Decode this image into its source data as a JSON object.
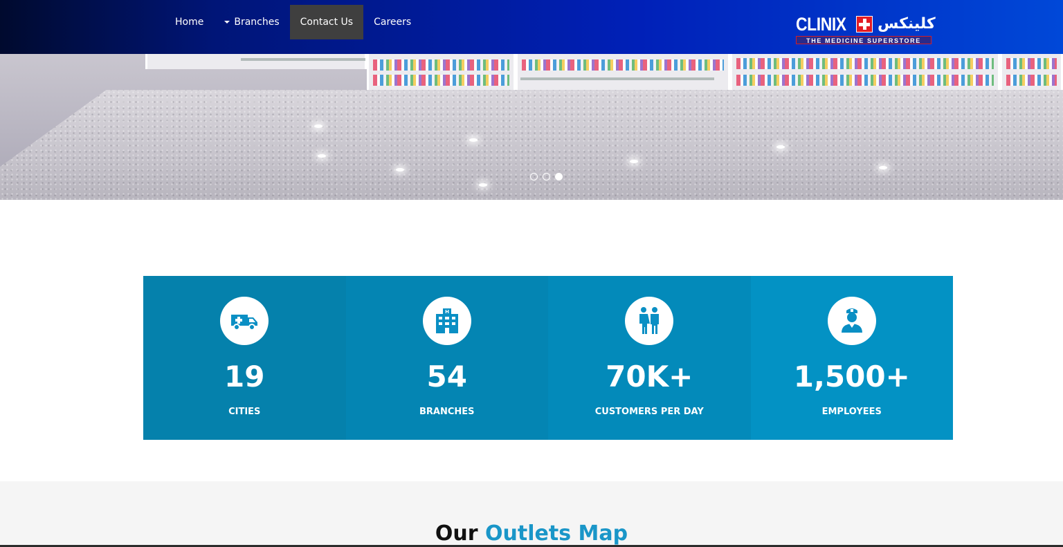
{
  "nav": {
    "items": [
      {
        "label": "Home",
        "active": false
      },
      {
        "label": "Branches",
        "active": false,
        "has_dropdown": true
      },
      {
        "label": "Contact Us",
        "active": true
      },
      {
        "label": "Careers",
        "active": false
      }
    ]
  },
  "logo": {
    "name": "CLINIX",
    "urdu": "کلینکس",
    "tagline": "THE MEDICINE SUPERSTORE"
  },
  "carousel": {
    "slide_count": 3,
    "active_slide": 3
  },
  "stats": [
    {
      "icon": "ambulance-icon",
      "value": "19",
      "label": "CITIES",
      "color": "#0581ac"
    },
    {
      "icon": "hospital-building-icon",
      "value": "54",
      "label": "BRANCHES",
      "color": "#0485b3"
    },
    {
      "icon": "people-couple-icon",
      "value": "70K+",
      "label": "CUSTOMERS PER DAY",
      "color": "#038aba"
    },
    {
      "icon": "nurse-icon",
      "value": "1,500+",
      "label": "EMPLOYEES",
      "color": "#0392c4"
    }
  ],
  "outlets": {
    "title_prefix": "Our",
    "title_accent": "Outlets Map"
  },
  "colors": {
    "header_gradient_start": "#000a2e",
    "header_gradient_end": "#0048d8",
    "nav_active_bg": "#3f3f3f",
    "accent_blue": "#1a96c8",
    "stat_icon_color": "#0a8fc4"
  }
}
